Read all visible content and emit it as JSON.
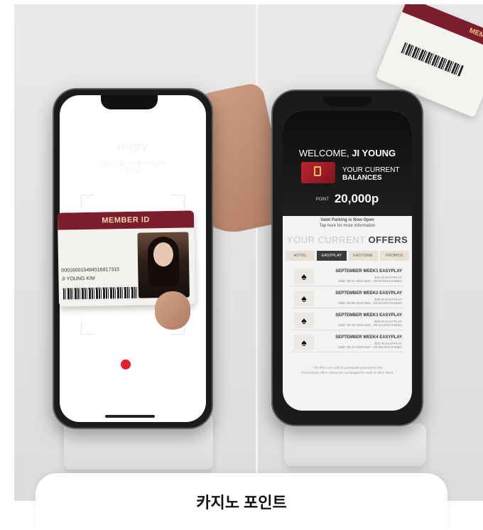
{
  "left_phone": {
    "app_logo": "nupy",
    "hint": "QR코드를 사각형 안에 맞춰\n주세요",
    "card": {
      "header": "MEMBER ID",
      "number": "000160015484516817315",
      "name": "JI YOUNG KIM"
    }
  },
  "right_phone": {
    "welcome_prefix": "WELCOME,",
    "welcome_name": "JI YOUNG",
    "balances_line1": "YOUR CURRENT",
    "balances_line2": "BALANCES",
    "points_label": "POINT",
    "points_value": "20,000p",
    "valet_title": "Valet Parking is Now Open",
    "valet_sub": "Tap here for more information",
    "offers_light": "YOUR CURRENT",
    "offers_bold": "OFFERS",
    "tabs": [
      "HOTEL",
      "EASYPLAY",
      "EASYDINE",
      "PROMOS"
    ],
    "active_tab": "EASYPLAY",
    "offers": [
      {
        "title": "SEPTEMBER WEEK1 EASYPLAY",
        "sub": "$30 IN EASYPLAY\nValid: 09-01-2023 9am - 09-08-2023 8:59am"
      },
      {
        "title": "SEPTEMBER WEEK2 EASYPLAY",
        "sub": "$30 IN EASYPLAY\nValid: 09-08-2023 9am - 09-15-2023 8:59am"
      },
      {
        "title": "SEPTEMBER WEEK3 EASYPLAY",
        "sub": "$30 IN EASYPLAY\nValid: 09-15-2023 9am - 09-22-2023 8:59am"
      },
      {
        "title": "SEPTEMBER WEEK4 EASYPLAY",
        "sub": "$30 IN EASYPLAY\nValid: 09-22-2023 9am - 09-29-2023 8:59am"
      }
    ],
    "footer_line1": "* All offers are valid at participating locations only",
    "footer_line2": "Promotional offers cannot be exchanged for cash or other items",
    "flying_card_header": "MEMBER"
  },
  "sheet": {
    "title": "카지노 포인트"
  },
  "colors": {
    "brand_red": "#7b1e2c",
    "record_red": "#e4202f",
    "dark": "#1b1b1b"
  }
}
